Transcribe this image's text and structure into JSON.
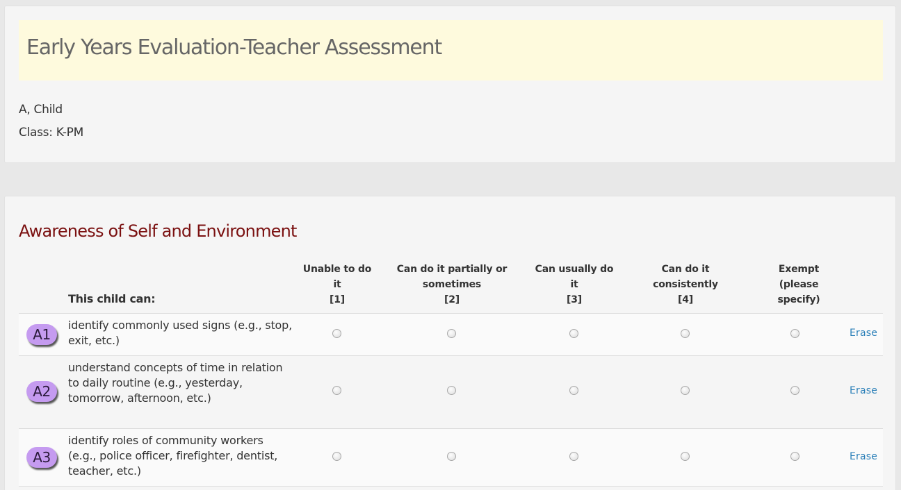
{
  "header": {
    "title": "Early Years Evaluation-Teacher Assessment",
    "student_name": "A, Child",
    "student_class": "Class: K-PM"
  },
  "section": {
    "title": "Awareness of Self and Environment",
    "label_header": "This child can:",
    "columns": [
      {
        "line1": "Unable to do",
        "line2": "it",
        "line3": "[1]"
      },
      {
        "line1": "Can do it partially or",
        "line2": "sometimes",
        "line3": "[2]"
      },
      {
        "line1": "Can usually do",
        "line2": "it",
        "line3": "[3]"
      },
      {
        "line1": "Can do it",
        "line2": "consistently",
        "line3": "[4]"
      },
      {
        "line1": "Exempt",
        "line2": "(please",
        "line3": "specify)"
      }
    ],
    "items": [
      {
        "code": "A1",
        "text": "identify commonly used signs (e.g., stop, exit, etc.)",
        "erase": "Erase"
      },
      {
        "code": "A2",
        "text": "understand concepts of time in relation to daily routine (e.g., yesterday, tomorrow, afternoon, etc.)",
        "erase": "Erase"
      },
      {
        "code": "A3",
        "text": "identify roles of community workers (e.g., police officer, firefighter, dentist, teacher, etc.)",
        "erase": "Erase"
      }
    ]
  },
  "colors": {
    "title_band": "#fefadd",
    "section_title": "#7a1010",
    "badge": "#c59bf0",
    "link": "#2a7fb8"
  }
}
